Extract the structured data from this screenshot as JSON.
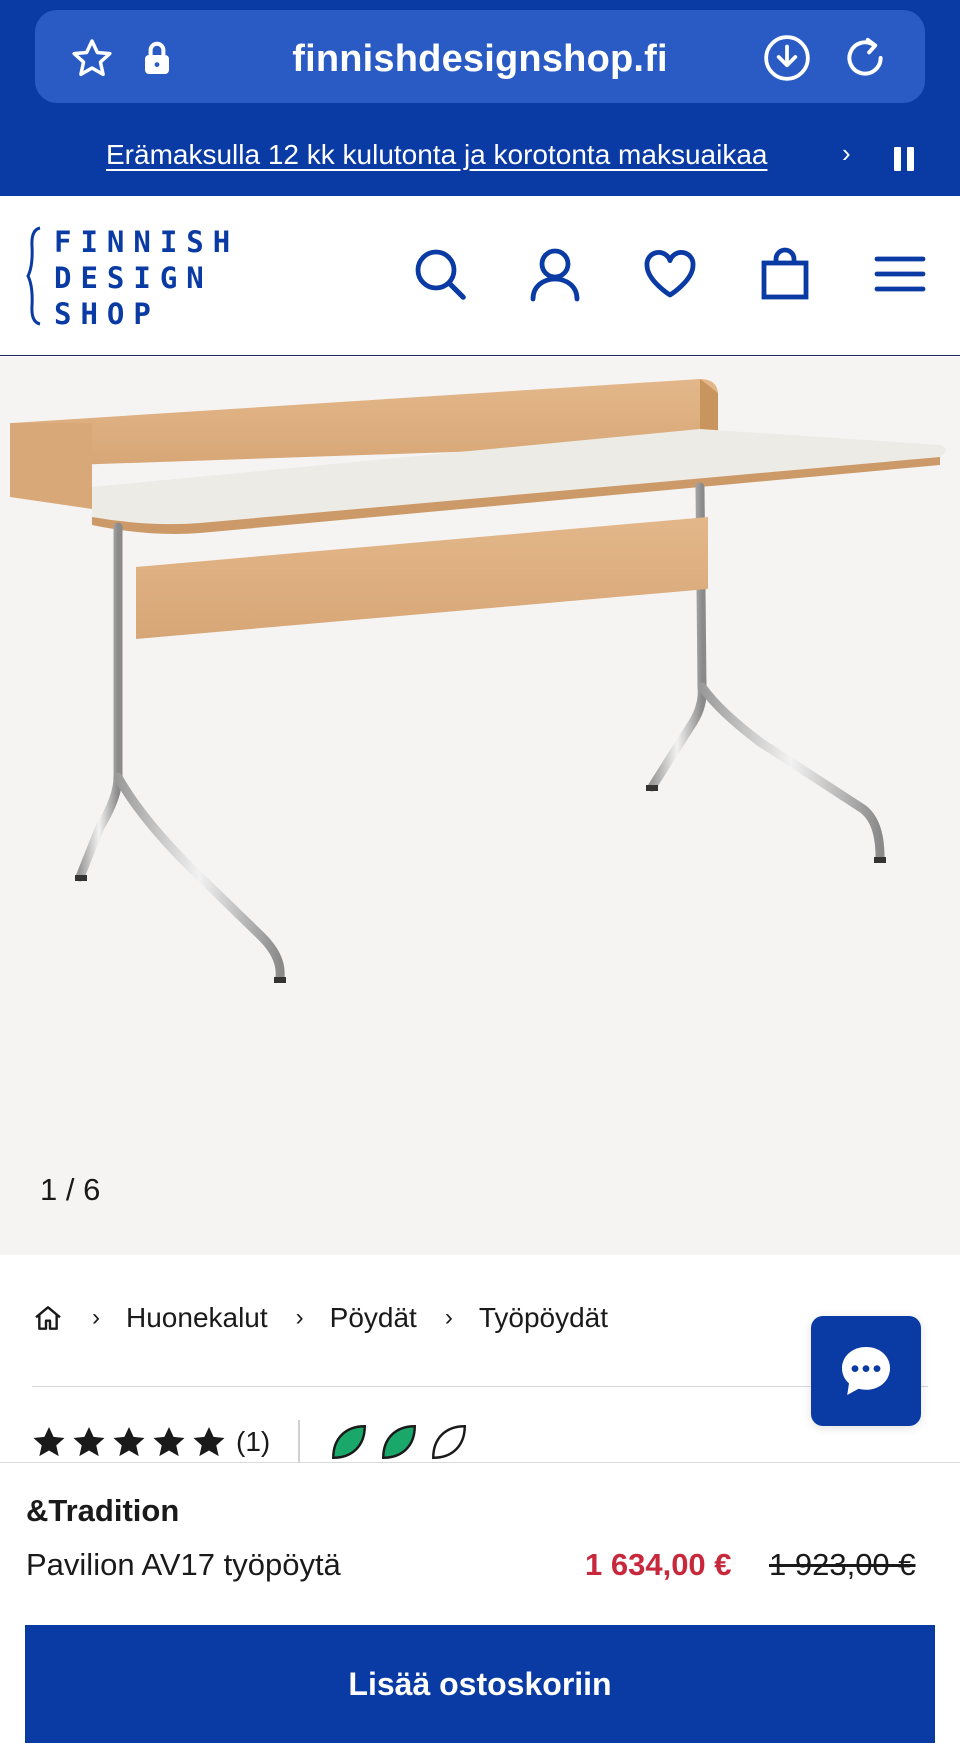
{
  "browser": {
    "url": "finnishdesignshop.fi"
  },
  "promo": {
    "text": "Erämaksulla 12 kk kulutonta ja korotonta maksuaikaa",
    "chevron": "›"
  },
  "header": {
    "logo_lines": [
      "FINNISH",
      "DESIGN",
      "SHOP"
    ],
    "icons": [
      "search-icon",
      "account-icon",
      "wishlist-heart-icon",
      "shopping-bag-icon",
      "menu-icon"
    ]
  },
  "gallery": {
    "counter": "1 / 6"
  },
  "breadcrumb": {
    "items": [
      "Huonekalut",
      "Pöydät",
      "Työpöydät"
    ]
  },
  "rating": {
    "stars": 5,
    "count": "(1)",
    "eco_leaves_filled": 2,
    "eco_leaves_total": 3
  },
  "product": {
    "brand": "&Tradition",
    "name": "Pavilion AV17 työpöytä",
    "price": "1 634,00 €",
    "old_price": "1 923,00 €",
    "add_to_cart": "Lisää ostoskoriin"
  },
  "colors": {
    "brand_blue": "#0a3aa3",
    "sale_red": "#c8283c",
    "eco_green": "#1aa86a"
  }
}
